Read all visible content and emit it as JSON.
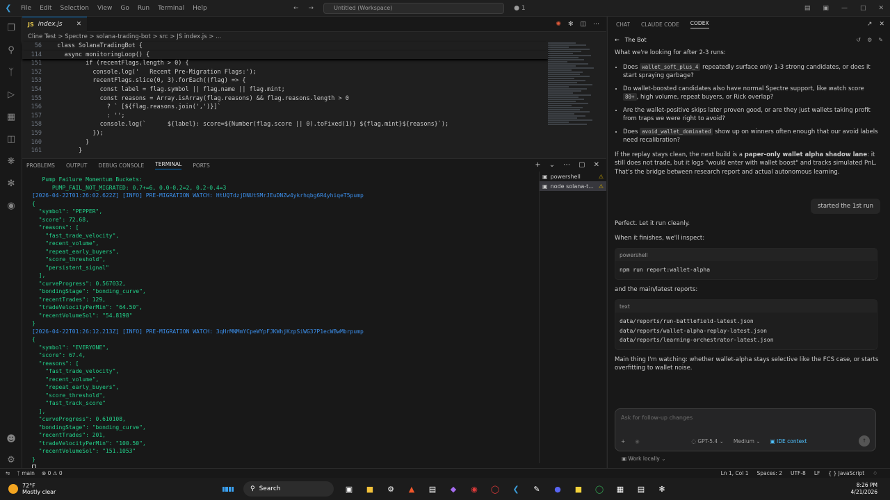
{
  "titlebar": {
    "menu": [
      "File",
      "Edit",
      "Selection",
      "View",
      "Go",
      "Run",
      "Terminal",
      "Help"
    ],
    "search": "Untitled (Workspace)",
    "badge": "1"
  },
  "editor": {
    "tab": {
      "icon": "JS",
      "name": "index.js"
    },
    "breadcrumb": "Cline Test  >  Spectre  >  solana-trading-bot  >  src  >  JS index.js  >  ...",
    "lines": [
      {
        "n": "56",
        "t": "  class SolanaTradingBot {"
      },
      {
        "n": "114",
        "t": "    async monitoringLoop() {"
      },
      {
        "n": "151",
        "t": "          if (recentFlags.length > 0) {"
      },
      {
        "n": "152",
        "t": "            console.log('   Recent Pre-Migration Flags:');"
      },
      {
        "n": "153",
        "t": "            recentFlags.slice(0, 3).forEach((flag) => {"
      },
      {
        "n": "154",
        "t": "              const label = flag.symbol || flag.name || flag.mint;"
      },
      {
        "n": "155",
        "t": "              const reasons = Array.isArray(flag.reasons) && flag.reasons.length > 0"
      },
      {
        "n": "156",
        "t": "                ? ` [${flag.reasons.join(',')}]`"
      },
      {
        "n": "157",
        "t": "                : '';"
      },
      {
        "n": "158",
        "t": "              console.log(`      ${label}: score=${Number(flag.score || 0).toFixed(1)} ${flag.mint}${reasons}`);"
      },
      {
        "n": "159",
        "t": "            });"
      },
      {
        "n": "160",
        "t": "          }"
      },
      {
        "n": "161",
        "t": "        }"
      }
    ]
  },
  "panel": {
    "tabs": [
      "PROBLEMS",
      "OUTPUT",
      "DEBUG CONSOLE",
      "TERMINAL",
      "PORTS"
    ],
    "active_tab": "TERMINAL",
    "terminals": [
      {
        "name": "powershell"
      },
      {
        "name": "node  solana-t..."
      }
    ],
    "output": [
      "   Pump Failure Momentum Buckets:",
      "      PUMP_FAIL_NOT_MIGRATED: 0.7+=6, 0.0-0.2=2, 0.2-0.4=3",
      "[2026-04-22T01:26:02.622Z] [INFO] PRE-MIGRATION WATCH: HtUQTdzjDNUtSMrJEuDNZw4ykrhqbg6R4yhiqeT5pump",
      "{",
      "  \"symbol\": \"PEPPER\",",
      "  \"score\": 72.68,",
      "  \"reasons\": [",
      "    \"fast_trade_velocity\",",
      "    \"recent_volume\",",
      "    \"repeat_early_buyers\",",
      "    \"score_threshold\",",
      "    \"persistent_signal\"",
      "  ],",
      "  \"curveProgress\": 0.567032,",
      "  \"bondingStage\": \"bonding_curve\",",
      "  \"recentTrades\": 129,",
      "  \"tradeVelocityPerMin\": \"64.50\",",
      "  \"recentVolumeSol\": \"54.8198\"",
      "}",
      "[2026-04-22T01:26:12.213Z] [INFO] PRE-MIGRATION WATCH: 3qHrMNMmYCpeWYpFJKWhjKzpSiWG37P1ecWBwMbrpump",
      "{",
      "  \"symbol\": \"EVERYONE\",",
      "  \"score\": 67.4,",
      "  \"reasons\": [",
      "    \"fast_trade_velocity\",",
      "    \"recent_volume\",",
      "    \"repeat_early_buyers\",",
      "    \"score_threshold\",",
      "    \"fast_track_score\"",
      "  ],",
      "  \"curveProgress\": 0.610108,",
      "  \"bondingStage\": \"bonding_curve\",",
      "  \"recentTrades\": 201,",
      "  \"tradeVelocityPerMin\": \"100.50\",",
      "  \"recentVolumeSol\": \"151.1053\"",
      "}"
    ]
  },
  "chat": {
    "tabs": [
      "CHAT",
      "CLAUDE CODE",
      "CODEX"
    ],
    "active_tab": "CODEX",
    "thread_title": "The Bot",
    "intro": "What we're looking for after 2-3 runs:",
    "bullets": [
      {
        "a": "Does ",
        "code": "wallet_soft_plus_4",
        "b": " repeatedly surface only 1-3 strong candidates, or does it start spraying garbage?"
      },
      {
        "a": "Do wallet-boosted candidates also have normal Spectre support, like watch score ",
        "code": "80+",
        "b": ", high volume, repeat buyers, or Rick overlap?"
      },
      {
        "a": "Are the wallet-positive skips later proven good, or are they just wallets taking profit from traps we were right to avoid?",
        "code": "",
        "b": ""
      },
      {
        "a": "Does ",
        "code": "avoid_wallet_dominated",
        "b": " show up on winners often enough that our avoid labels need recalibration?"
      }
    ],
    "para1_a": "If the replay stays clean, the next build is a ",
    "para1_bold": "paper-only wallet alpha shadow lane",
    "para1_b": ": it still does not trade, but it logs \"would enter with wallet boost\" and tracks simulated PnL. That's the bridge between research report and actual autonomous learning.",
    "user_msg": "started the 1st run",
    "reply1": "Perfect. Let it run cleanly.",
    "reply2": "When it finishes, we'll inspect:",
    "block1": {
      "lang": "powershell",
      "code": "npm run report:wallet-alpha"
    },
    "reply3": "and the main/latest reports:",
    "block2": {
      "lang": "text",
      "code": "data/reports/run-battlefield-latest.json\ndata/reports/wallet-alpha-replay-latest.json\ndata/reports/learning-orchestrator-latest.json"
    },
    "reply4": "Main thing I'm watching: whether wallet-alpha stays selective like the FCS case, or starts overfitting to wallet noise.",
    "input_placeholder": "Ask for follow-up changes",
    "model": "GPT-5.4",
    "effort": "Medium",
    "ide_context": "IDE context",
    "work_mode": "Work locally"
  },
  "statusbar": {
    "branch": "main",
    "problems": "0",
    "warnings": "0",
    "position": "Ln 1, Col 1",
    "spaces": "Spaces: 2",
    "encoding": "UTF-8",
    "eol": "LF",
    "language": "JavaScript"
  },
  "taskbar": {
    "temp": "72°F",
    "weather": "Mostly clear",
    "search": "Search",
    "time": "8:26 PM",
    "date": "4/21/2026"
  }
}
